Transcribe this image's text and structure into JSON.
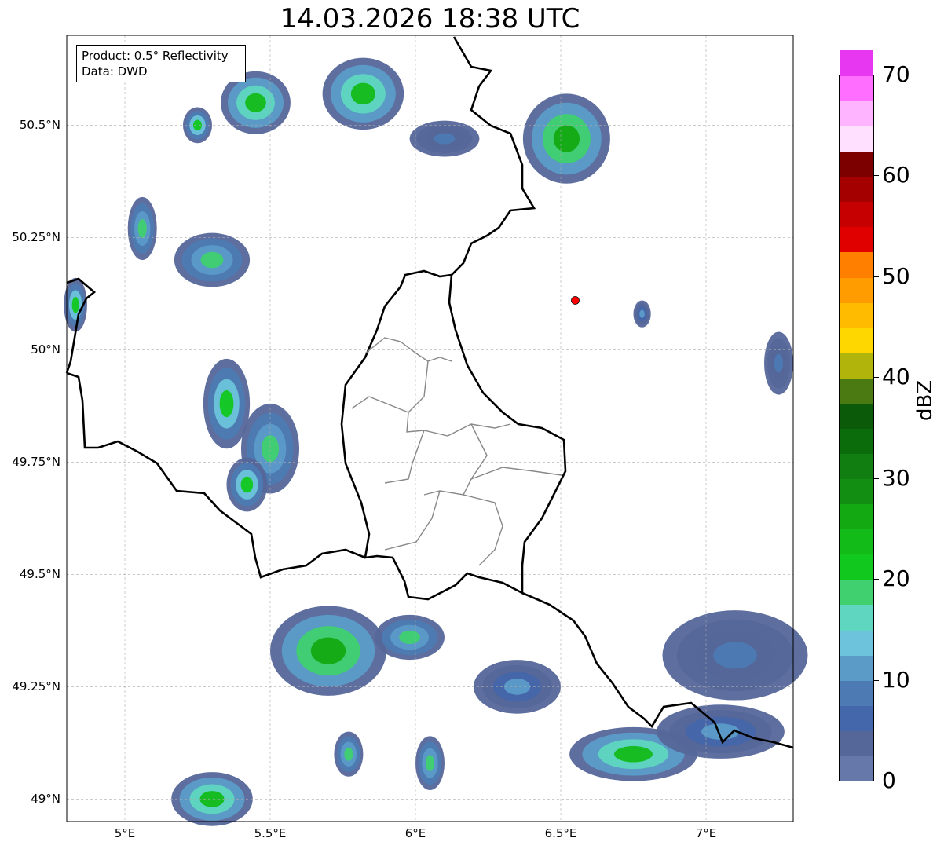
{
  "title": "14.03.2026 18:38 UTC",
  "info_box": {
    "product": "Product: 0.5° Reflectivity",
    "data": "Data: DWD"
  },
  "lat_labels": [
    "50.5°N",
    "50.25°N",
    "50°N",
    "49.75°N",
    "49.5°N",
    "49.25°N",
    "49°N"
  ],
  "lat_values": [
    50.5,
    50.25,
    50.0,
    49.75,
    49.5,
    49.25,
    49.0
  ],
  "lon_labels": [
    "5°E",
    "5.5°E",
    "6°E",
    "6.5°E",
    "7°E"
  ],
  "lon_values": [
    5.0,
    5.5,
    6.0,
    6.5,
    7.0
  ],
  "extent": {
    "lon_min": 4.8,
    "lon_max": 7.3,
    "lat_min": 48.95,
    "lat_max": 50.7
  },
  "radar_site": {
    "lon": 6.55,
    "lat": 50.11,
    "color": "#ff0000"
  },
  "colorbar": {
    "label": "dBZ",
    "min": 0,
    "max": 70,
    "step": 2.5,
    "ticks": [
      "0",
      "10",
      "20",
      "30",
      "40",
      "50",
      "60",
      "70"
    ],
    "tick_values": [
      0,
      10,
      20,
      30,
      40,
      50,
      60,
      70
    ],
    "colors": [
      "#6677aa",
      "#556699",
      "#4466aa",
      "#4d7ab3",
      "#5b9bc8",
      "#6cc3db",
      "#5fd6c0",
      "#40d070",
      "#11c81e",
      "#12bb18",
      "#12a912",
      "#128f12",
      "#107e10",
      "#0b6c0b",
      "#0a5a0a",
      "#4b7a12",
      "#b0b40b",
      "#ffd700",
      "#ffbb00",
      "#ff9d00",
      "#ff7f00",
      "#e10000",
      "#c60000",
      "#a50000",
      "#7c0000",
      "#ffe0ff",
      "#ffb4ff",
      "#ff6eff",
      "#e837f0"
    ]
  },
  "echoes": [
    {
      "lon": 5.82,
      "lat": 50.57,
      "rx": 0.14,
      "ry": 0.08,
      "dbz": 20
    },
    {
      "lon": 5.45,
      "lat": 50.55,
      "rx": 0.12,
      "ry": 0.07,
      "dbz": 20
    },
    {
      "lon": 6.52,
      "lat": 50.47,
      "rx": 0.15,
      "ry": 0.1,
      "dbz": 22
    },
    {
      "lon": 6.1,
      "lat": 50.47,
      "rx": 0.12,
      "ry": 0.04,
      "dbz": 5
    },
    {
      "lon": 5.25,
      "lat": 50.5,
      "rx": 0.05,
      "ry": 0.04,
      "dbz": 16
    },
    {
      "lon": 5.3,
      "lat": 50.2,
      "rx": 0.13,
      "ry": 0.06,
      "dbz": 15
    },
    {
      "lon": 5.06,
      "lat": 50.27,
      "rx": 0.05,
      "ry": 0.07,
      "dbz": 14
    },
    {
      "lon": 5.35,
      "lat": 49.88,
      "rx": 0.08,
      "ry": 0.1,
      "dbz": 16
    },
    {
      "lon": 5.5,
      "lat": 49.78,
      "rx": 0.1,
      "ry": 0.1,
      "dbz": 14
    },
    {
      "lon": 5.42,
      "lat": 49.7,
      "rx": 0.07,
      "ry": 0.06,
      "dbz": 16
    },
    {
      "lon": 5.7,
      "lat": 49.33,
      "rx": 0.2,
      "ry": 0.1,
      "dbz": 22
    },
    {
      "lon": 5.98,
      "lat": 49.36,
      "rx": 0.12,
      "ry": 0.05,
      "dbz": 14
    },
    {
      "lon": 6.35,
      "lat": 49.25,
      "rx": 0.15,
      "ry": 0.06,
      "dbz": 8
    },
    {
      "lon": 6.75,
      "lat": 49.1,
      "rx": 0.22,
      "ry": 0.06,
      "dbz": 20
    },
    {
      "lon": 7.1,
      "lat": 49.32,
      "rx": 0.25,
      "ry": 0.1,
      "dbz": 5
    },
    {
      "lon": 7.05,
      "lat": 49.15,
      "rx": 0.22,
      "ry": 0.06,
      "dbz": 8
    },
    {
      "lon": 5.3,
      "lat": 49.0,
      "rx": 0.14,
      "ry": 0.06,
      "dbz": 20
    },
    {
      "lon": 5.77,
      "lat": 49.1,
      "rx": 0.05,
      "ry": 0.05,
      "dbz": 14
    },
    {
      "lon": 6.05,
      "lat": 49.08,
      "rx": 0.05,
      "ry": 0.06,
      "dbz": 14
    },
    {
      "lon": 7.25,
      "lat": 49.97,
      "rx": 0.05,
      "ry": 0.07,
      "dbz": 5
    },
    {
      "lon": 6.78,
      "lat": 50.08,
      "rx": 0.03,
      "ry": 0.03,
      "dbz": 8
    },
    {
      "lon": 4.83,
      "lat": 50.1,
      "rx": 0.04,
      "ry": 0.06,
      "dbz": 16
    }
  ]
}
